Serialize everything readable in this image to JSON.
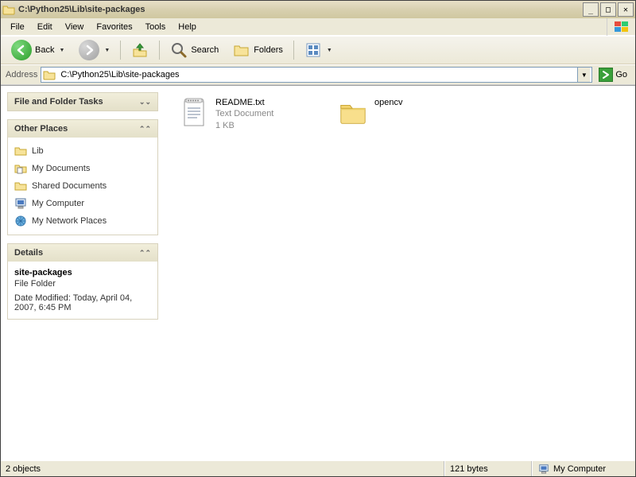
{
  "titlebar": {
    "title": "C:\\Python25\\Lib\\site-packages"
  },
  "menubar": {
    "file": "File",
    "edit": "Edit",
    "view": "View",
    "favorites": "Favorites",
    "tools": "Tools",
    "help": "Help"
  },
  "toolbar": {
    "back": "Back",
    "search": "Search",
    "folders": "Folders"
  },
  "addressbar": {
    "label": "Address",
    "value": "C:\\Python25\\Lib\\site-packages",
    "go": "Go"
  },
  "sidebar": {
    "file_folder_tasks": {
      "title": "File and Folder Tasks"
    },
    "other_places": {
      "title": "Other Places",
      "items": [
        {
          "label": "Lib",
          "icon": "folder"
        },
        {
          "label": "My Documents",
          "icon": "mydocs"
        },
        {
          "label": "Shared Documents",
          "icon": "folder"
        },
        {
          "label": "My Computer",
          "icon": "computer"
        },
        {
          "label": "My Network Places",
          "icon": "network"
        }
      ]
    },
    "details": {
      "title": "Details",
      "name": "site-packages",
      "type": "File Folder",
      "modified": "Date Modified: Today, April 04, 2007, 6:45 PM"
    }
  },
  "content": {
    "items": [
      {
        "name": "README.txt",
        "type": "Text Document",
        "size": "1 KB",
        "kind": "txt"
      },
      {
        "name": "opencv",
        "type": "",
        "size": "",
        "kind": "folder"
      }
    ]
  },
  "statusbar": {
    "objects": "2 objects",
    "size": "121 bytes",
    "location": "My Computer"
  }
}
